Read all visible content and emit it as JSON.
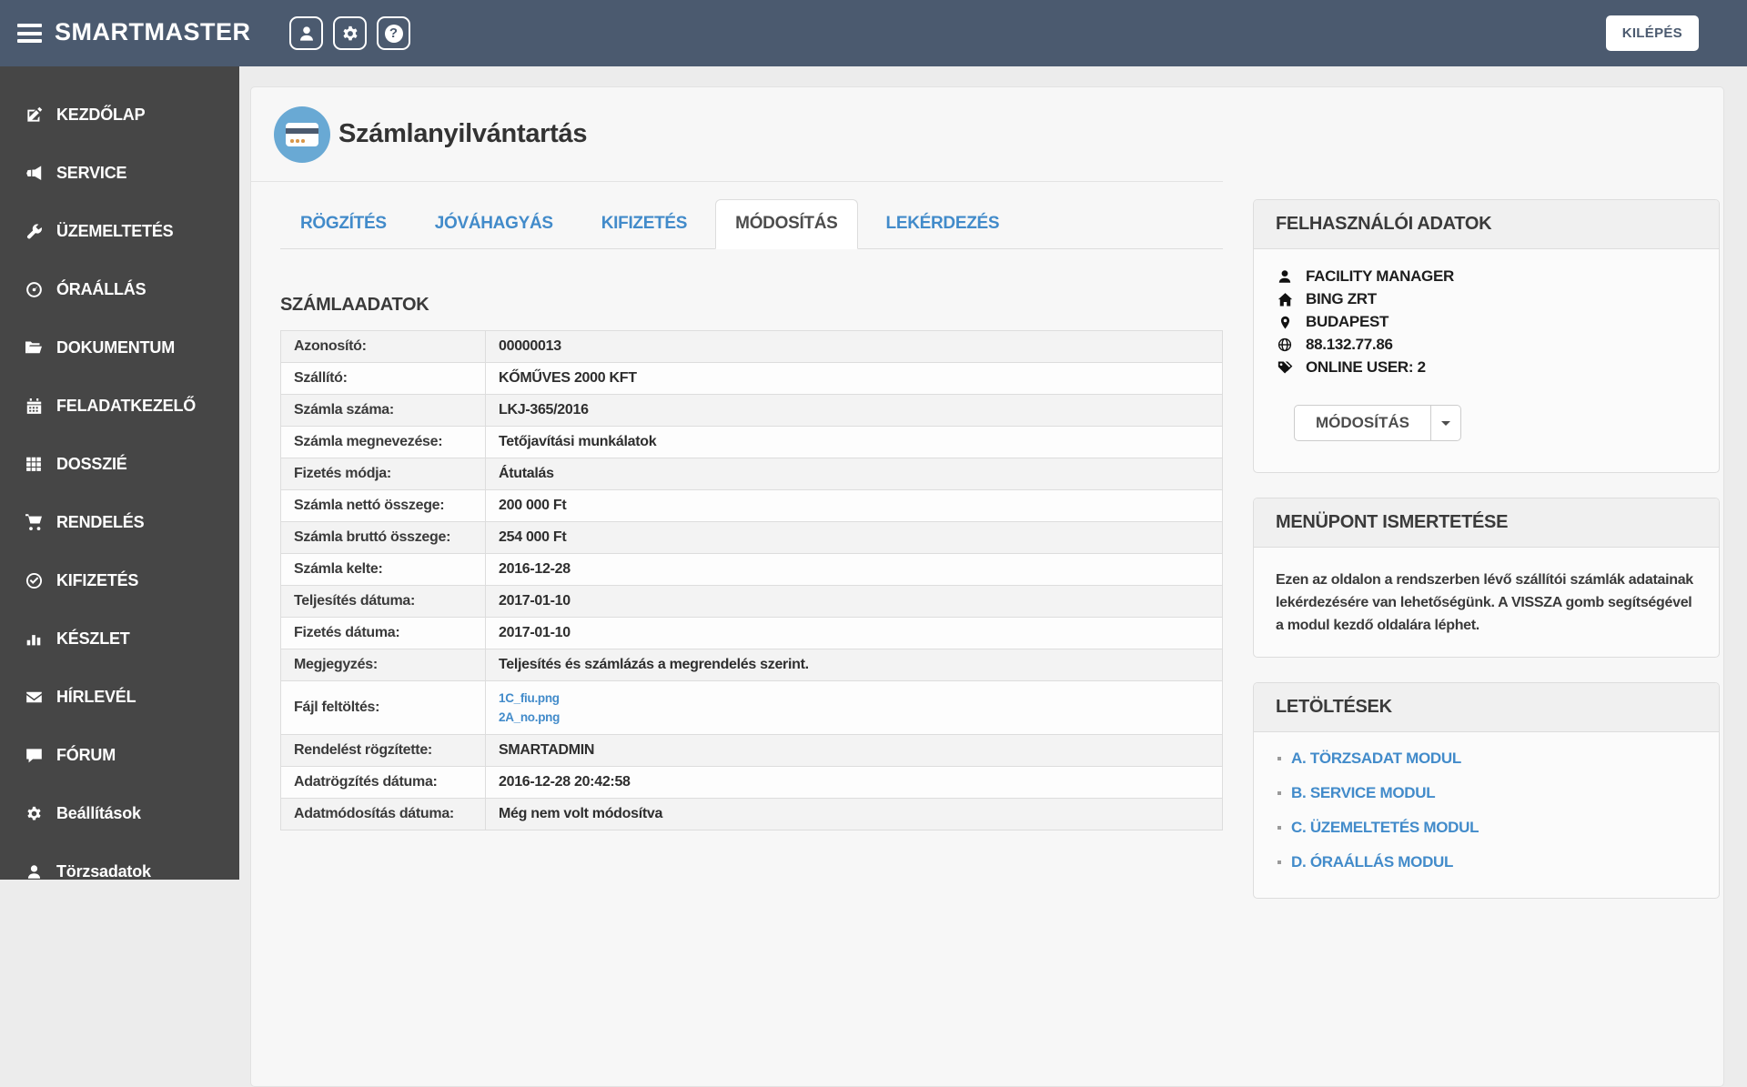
{
  "header": {
    "brand": "SMARTMASTER",
    "logout_label": "KILÉPÉS"
  },
  "sidebar": {
    "items": [
      {
        "label": "KEZDŐLAP",
        "icon": "edit-icon"
      },
      {
        "label": "SERVICE",
        "icon": "megaphone-icon"
      },
      {
        "label": "ÜZEMELTETÉS",
        "icon": "wrench-icon"
      },
      {
        "label": "ÓRAÁLLÁS",
        "icon": "meter-icon"
      },
      {
        "label": "DOKUMENTUM",
        "icon": "folder-open-icon"
      },
      {
        "label": "FELADATKEZELŐ",
        "icon": "calendar-icon"
      },
      {
        "label": "DOSSZIÉ",
        "icon": "grid-icon"
      },
      {
        "label": "RENDELÉS",
        "icon": "cart-icon"
      },
      {
        "label": "KIFIZETÉS",
        "icon": "check-circle-icon"
      },
      {
        "label": "KÉSZLET",
        "icon": "bar-chart-icon"
      },
      {
        "label": "HÍRLEVÉL",
        "icon": "envelope-icon"
      },
      {
        "label": "FÓRUM",
        "icon": "comment-icon"
      },
      {
        "label": "Beállítások",
        "icon": "gear-icon"
      },
      {
        "label": "Törzsadatok",
        "icon": "user-icon"
      }
    ]
  },
  "page": {
    "title": "Számlanyilvántartás",
    "tabs": [
      {
        "label": "RÖGZÍTÉS",
        "active": false
      },
      {
        "label": "JÓVÁHAGYÁS",
        "active": false
      },
      {
        "label": "KIFIZETÉS",
        "active": false
      },
      {
        "label": "MÓDOSÍTÁS",
        "active": true
      },
      {
        "label": "LEKÉRDEZÉS",
        "active": false
      }
    ],
    "section_title": "SZÁMLAADATOK",
    "invoice_fields": [
      {
        "label": "Azonosító:",
        "value": "00000013"
      },
      {
        "label": "Szállító:",
        "value": "KŐMŰVES 2000 KFT"
      },
      {
        "label": "Számla száma:",
        "value": "LKJ-365/2016"
      },
      {
        "label": "Számla megnevezése:",
        "value": "Tetőjavítási munkálatok"
      },
      {
        "label": "Fizetés módja:",
        "value": "Átutalás"
      },
      {
        "label": "Számla nettó összege:",
        "value": "200 000 Ft"
      },
      {
        "label": "Számla bruttó összege:",
        "value": "254 000 Ft"
      },
      {
        "label": "Számla kelte:",
        "value": "2016-12-28"
      },
      {
        "label": "Teljesítés dátuma:",
        "value": "2017-01-10"
      },
      {
        "label": "Fizetés dátuma:",
        "value": "2017-01-10"
      },
      {
        "label": "Megjegyzés:",
        "value": "Teljesítés és számlázás a megrendelés szerint."
      },
      {
        "label": "Fájl feltöltés:",
        "links": [
          "1C_fiu.png",
          "2A_no.png"
        ]
      },
      {
        "label": "Rendelést rögzítette:",
        "value": "SMARTADMIN"
      },
      {
        "label": "Adatrögzítés dátuma:",
        "value": "2016-12-28 20:42:58"
      },
      {
        "label": "Adatmódosítás dátuma:",
        "value": "Még nem volt módosítva"
      }
    ]
  },
  "user_panel": {
    "title": "FELHASZNÁLÓI ADATOK",
    "items": [
      {
        "icon": "user-icon",
        "text": "FACILITY MANAGER"
      },
      {
        "icon": "home-icon",
        "text": "BING ZRT"
      },
      {
        "icon": "map-pin-icon",
        "text": "BUDAPEST"
      },
      {
        "icon": "globe-icon",
        "text": "88.132.77.86"
      },
      {
        "icon": "tags-icon",
        "text": "ONLINE USER: 2"
      }
    ],
    "button_label": "MÓDOSÍTÁS"
  },
  "info_panel": {
    "title": "MENÜPONT ISMERTETÉSE",
    "text": "Ezen az oldalon a rendszerben lévő szállítói számlák adatainak lekérdezésére van lehetőségünk. A VISSZA gomb segítségével a modul kezdő oldalára léphet."
  },
  "downloads_panel": {
    "title": "LETÖLTÉSEK",
    "links": [
      "A. TÖRZSADAT MODUL",
      "B. SERVICE MODUL",
      "C. ÜZEMELTETÉS MODUL",
      "D. ÓRAÁLLÁS MODUL"
    ]
  },
  "colors": {
    "header_bg": "#4b5a6f",
    "sidebar_bg": "#464646",
    "link_blue": "#428bca",
    "title_icon_blue": "#69a9d4",
    "card_dots_orange": "#d9984a",
    "card_bg": "#f7f7f7",
    "panel_header_bg": "#f0f0f0",
    "stripe_row": "#f3f3f3"
  }
}
